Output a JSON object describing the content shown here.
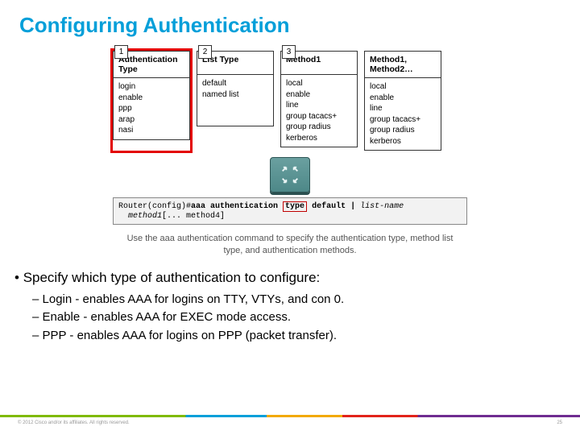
{
  "title": "Configuring Authentication",
  "cols": [
    {
      "n": "1",
      "header": "Authentication Type",
      "body": "login\nenable\nppp\narap\nnasi",
      "highlight": true
    },
    {
      "n": "2",
      "header": "List Type",
      "body": "default\nnamed list",
      "highlight": false
    },
    {
      "n": "3",
      "header": "Method1",
      "body": "local\nenable\nline\ngroup tacacs+\ngroup radius\nkerberos",
      "highlight": false
    },
    {
      "n": "",
      "header": "Method1, Method2…",
      "body": "local\nenable\nline\ngroup tacacs+\ngroup radius\nkerberos",
      "highlight": false
    }
  ],
  "cmd": {
    "prompt": "Router(config)#",
    "pre": "aaa authentication ",
    "hl": "type",
    "mid": " default | ",
    "italic1": "list-name",
    "line2a": "method1",
    "line2b": "[... method4]"
  },
  "caption": "Use the aaa authentication command to specify the authentication type, method list type, and authentication methods.",
  "lead": "Specify which type of authentication to configure:",
  "subs": [
    "Login - enables AAA for logins on TTY, VTYs, and con 0.",
    "Enable - enables AAA for EXEC mode access.",
    "PPP  - enables AAA for logins on PPP (packet transfer)."
  ],
  "footer": {
    "left": "© 2012 Cisco and/or its affiliates. All rights reserved.",
    "right": "25"
  }
}
